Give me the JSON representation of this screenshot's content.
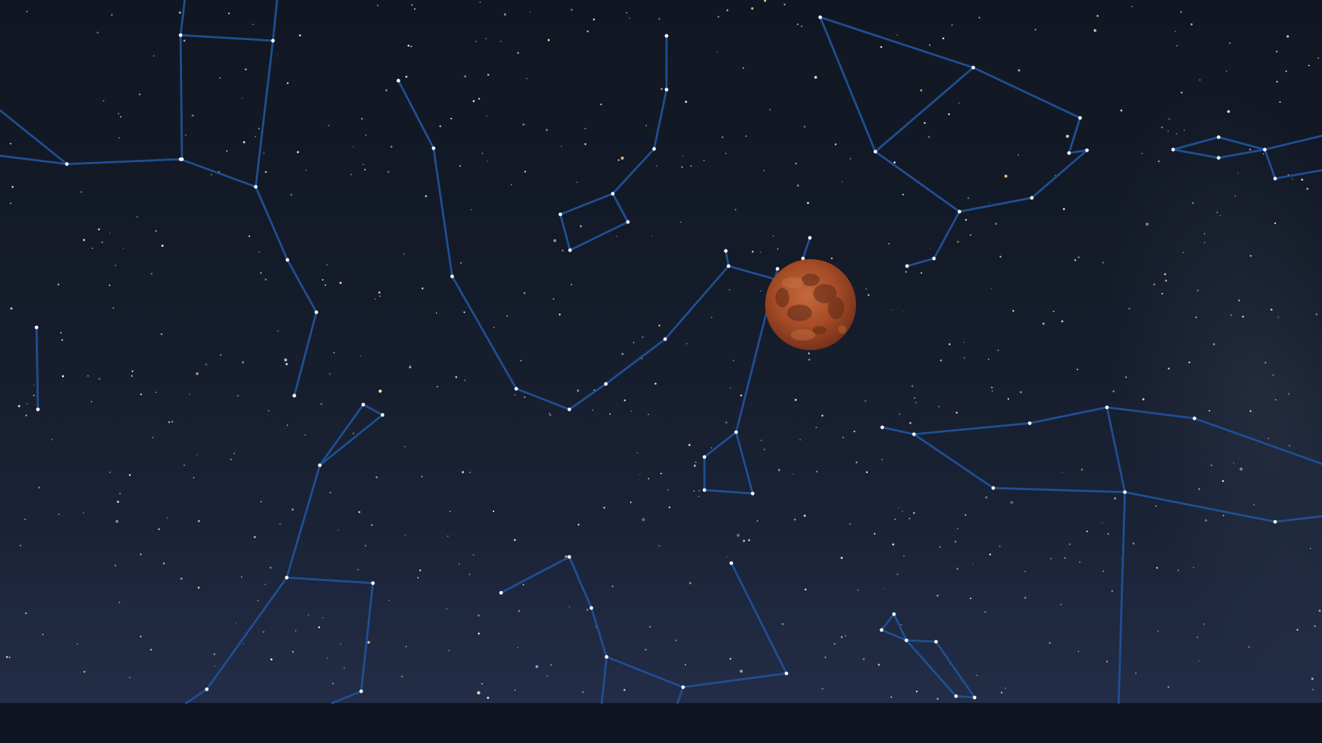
{
  "scene": {
    "subject": "",
    "moon_color": "#a44a25",
    "constellation_line_color": "#1f4f93",
    "sky_top_color": "#111722",
    "sky_bottom_color": "#232d47",
    "ground_color": "#0e1420"
  }
}
